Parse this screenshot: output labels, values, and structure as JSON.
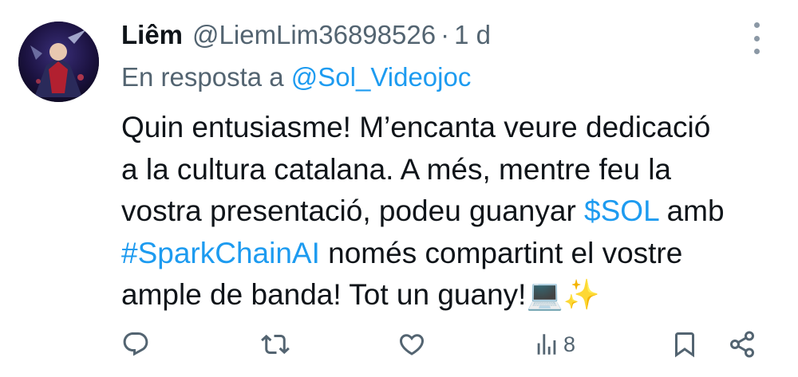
{
  "tweet": {
    "author_name": "Liêm",
    "author_handle": "@LiemLim36898526",
    "separator": "·",
    "timestamp": "1 d",
    "reply_prefix": "En resposta a",
    "reply_to": "@Sol_Videojoc",
    "body": {
      "line1": "Quin entusiasme! M’encanta veure dedicació",
      "line2": "a la cultura catalana. A més, mentre feu la",
      "line3_a": "vostra presentació, podeu guanyar ",
      "line3_cashtag": "$SOL",
      "line3_b": " amb",
      "line4_hashtag": "#SparkChainAI",
      "line4_b": " només compartint el vostre",
      "line5": "ample de banda! Tot un guany!",
      "emoji": "💻✨"
    },
    "stats": {
      "views": "8"
    }
  },
  "icons": {
    "more": "more-vertical-icon",
    "reply": "reply-icon",
    "retweet": "retweet-icon",
    "like": "heart-icon",
    "views": "analytics-icon",
    "bookmark": "bookmark-icon",
    "share": "share-icon"
  },
  "colors": {
    "text": "#0f1419",
    "secondary": "#536471",
    "link": "#1d9bf0"
  }
}
